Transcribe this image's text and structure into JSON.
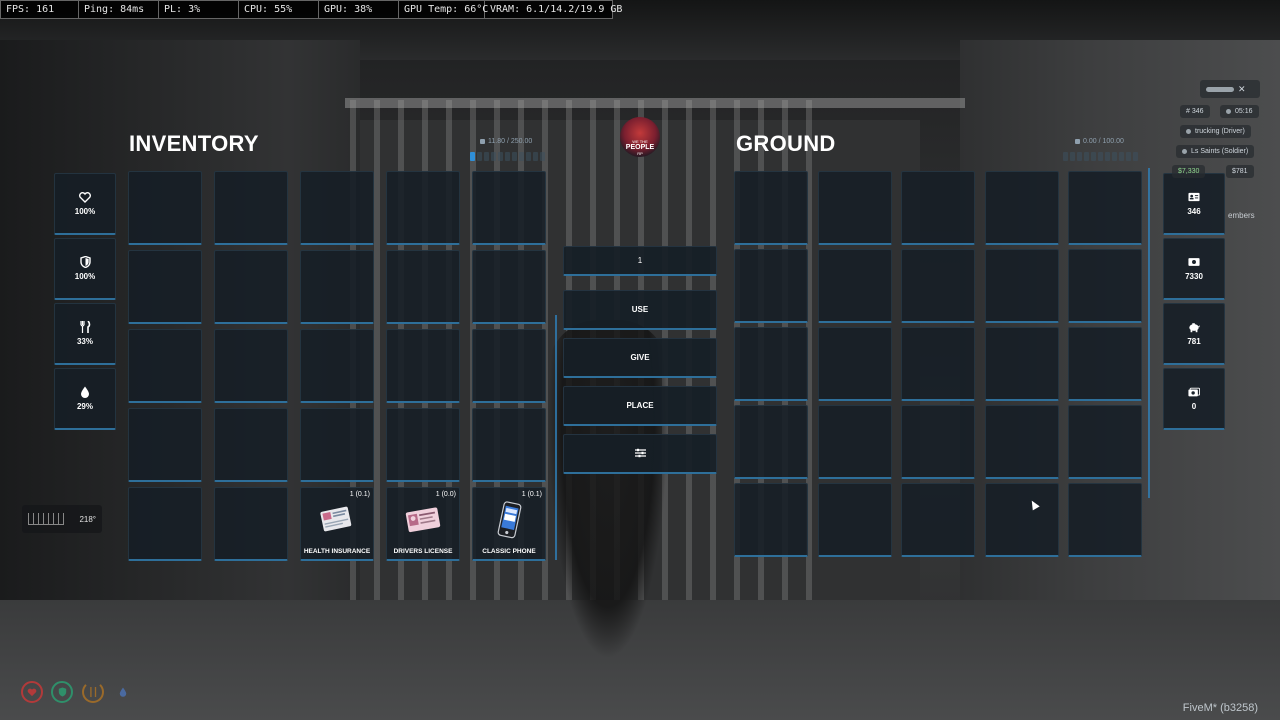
{
  "perf": {
    "fps": "FPS: 161",
    "ping": "Ping: 84ms",
    "pl": "PL: 3%",
    "cpu": "CPU: 55%",
    "gpu": "GPU: 38%",
    "gpu_temp": "GPU Temp: 66°C",
    "vram": "VRAM: 6.1/14.2/19.9 GB"
  },
  "inventory": {
    "title": "INVENTORY",
    "weight": "11.80 / 250.00",
    "weight_fraction": 0.05,
    "items": [
      {
        "slot": 22,
        "name": "HEALTH INSURANCE",
        "count": "1 (0.1)",
        "icon": "health-insurance-card-icon"
      },
      {
        "slot": 23,
        "name": "DRIVERS LICENSE",
        "count": "1 (0.0)",
        "icon": "drivers-license-card-icon"
      },
      {
        "slot": 24,
        "name": "CLASSIC PHONE",
        "count": "1 (0.1)",
        "icon": "classic-phone-icon"
      }
    ]
  },
  "ground": {
    "title": "GROUND",
    "weight": "0.00 / 100.00",
    "weight_fraction": 0.0
  },
  "logo": {
    "line1": "WE THE",
    "line2": "PEOPLE",
    "line3": "RP"
  },
  "stats_left": [
    {
      "icon": "heart-icon",
      "value": "100%"
    },
    {
      "icon": "shield-icon",
      "value": "100%"
    },
    {
      "icon": "fork-knife-icon",
      "value": "33%"
    },
    {
      "icon": "water-drop-icon",
      "value": "29%"
    }
  ],
  "stats_right": [
    {
      "icon": "id-card-icon",
      "value": "346"
    },
    {
      "icon": "cash-icon",
      "value": "7330"
    },
    {
      "icon": "piggy-bank-icon",
      "value": "781"
    },
    {
      "icon": "dirty-money-icon",
      "value": "0"
    }
  ],
  "menu": {
    "qty": "1",
    "use": "USE",
    "give": "GIVE",
    "place": "PLACE",
    "settings_icon": "sliders-icon"
  },
  "hud": {
    "id": "# 346",
    "time": "05:16",
    "job1": "trucking (Driver)",
    "job2": "Ls Saints (Soldier)",
    "money_left": "$7,330",
    "money_right": "$781",
    "members": "embers"
  },
  "compass": {
    "deg": "218°"
  },
  "footer": {
    "client": "FiveM* (b3258)"
  },
  "colors": {
    "accent": "#2f8fd8",
    "slot_border": "#2e6f9a"
  }
}
